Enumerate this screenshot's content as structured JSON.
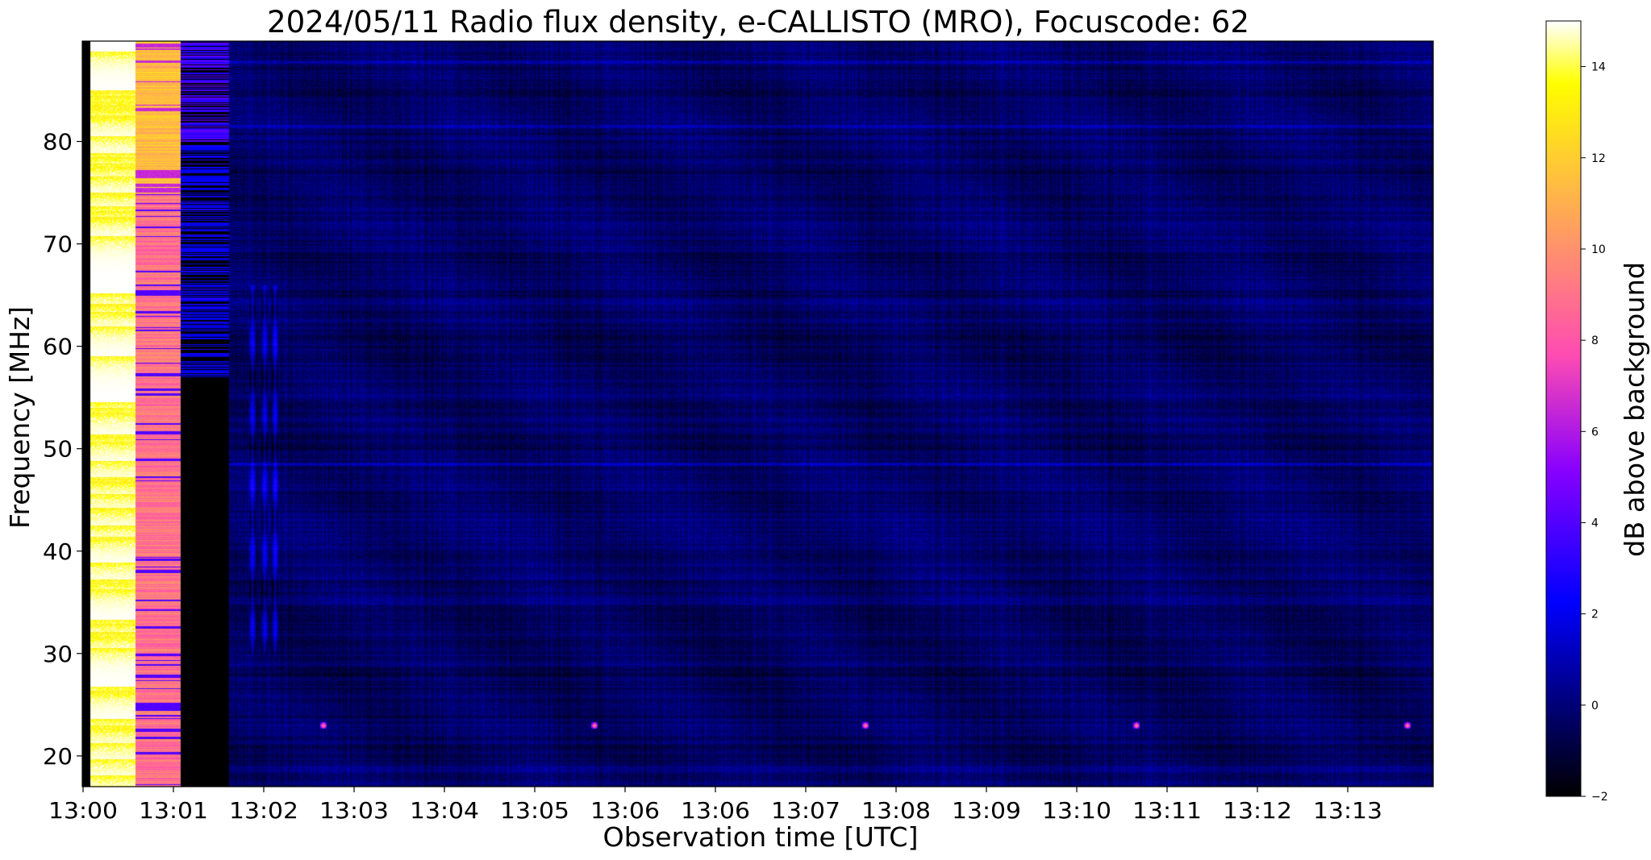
{
  "chart_data": {
    "type": "heatmap",
    "title": "2024/05/11  Radio flux density, e-CALLISTO (MRO), Focuscode: 62",
    "xlabel": "Observation time [UTC]",
    "ylabel": "Frequency [MHz]",
    "xlim": [
      "13:00:00",
      "13:14:57"
    ],
    "ylim": [
      17,
      89.8
    ],
    "x_tick_labels": [
      "13:00",
      "13:01",
      "13:02",
      "13:03",
      "13:04",
      "13:05",
      "13:06",
      "13:06",
      "13:07",
      "13:08",
      "13:09",
      "13:10",
      "13:11",
      "13:12",
      "13:13"
    ],
    "y_ticks": [
      20,
      30,
      40,
      50,
      60,
      70,
      80
    ],
    "grid": false,
    "colormap": "gnuplot2",
    "colorbar": {
      "label": "dB above background",
      "range": [
        -2,
        15
      ],
      "ticks": [
        -2,
        0,
        2,
        4,
        6,
        8,
        10,
        12,
        14
      ]
    },
    "segments": [
      {
        "start": "13:00:00",
        "end": "13:00:05",
        "level_db": -2
      },
      {
        "start": "13:00:05",
        "end": "13:00:35",
        "level_db": 15,
        "note": "saturated, yellow bands ~13 dB"
      },
      {
        "start": "13:00:35",
        "end": "13:01:05",
        "level_db": 9,
        "note": "pink/orange, blue dips ~4 dB"
      },
      {
        "start": "13:01:05",
        "end": "13:01:37",
        "level_db": -2,
        "note": "blue bands 2-4 dB above 57 MHz"
      },
      {
        "start": "13:01:37",
        "end": "13:14:57",
        "level_db": -0.3,
        "note": "background noise"
      }
    ],
    "horizontal_lines": [
      {
        "freq_mhz": 48.5,
        "level_db": 2
      },
      {
        "freq_mhz": 81.5,
        "level_db": 1.8
      },
      {
        "freq_mhz": 87.8,
        "level_db": 1.5
      }
    ],
    "vertical_stripes": [
      {
        "time": "13:01:53",
        "freq_range": [
          30,
          66
        ],
        "level_db": 3
      },
      {
        "time": "13:02:01",
        "freq_range": [
          30,
          66
        ],
        "level_db": 3
      },
      {
        "time": "13:02:08",
        "freq_range": [
          30,
          66
        ],
        "level_db": 3
      }
    ],
    "bursts": [
      {
        "time": "13:02:40",
        "freq_mhz": 23,
        "level_db": 10
      },
      {
        "time": "13:05:40",
        "freq_mhz": 23,
        "level_db": 10
      },
      {
        "time": "13:08:40",
        "freq_mhz": 23,
        "level_db": 10
      },
      {
        "time": "13:11:40",
        "freq_mhz": 23,
        "level_db": 10
      },
      {
        "time": "13:14:40",
        "freq_mhz": 23,
        "level_db": 10
      }
    ]
  }
}
